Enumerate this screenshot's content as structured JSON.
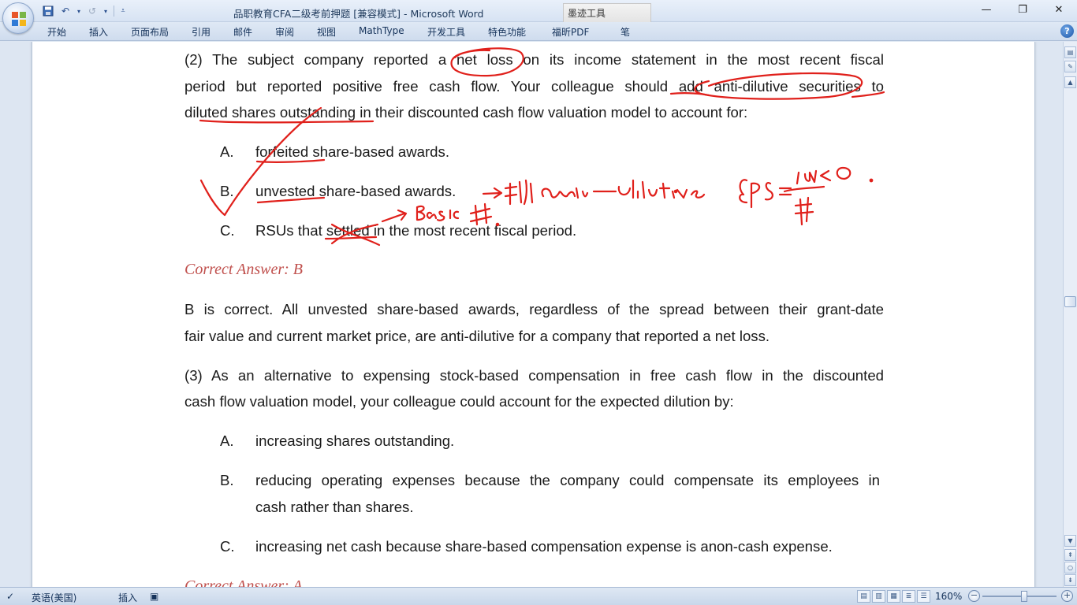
{
  "window": {
    "title": "品职教育CFA二级考前押题 [兼容模式] - Microsoft Word",
    "context_tab": "墨迹工具"
  },
  "ribbon": {
    "tabs": [
      "开始",
      "插入",
      "页面布局",
      "引用",
      "邮件",
      "审阅",
      "视图",
      "MathType",
      "开发工具",
      "特色功能",
      "福昕PDF",
      "笔"
    ]
  },
  "document": {
    "q2": {
      "lines": [
        "(2) The subject company reported a net loss on its income statement in the most recent fiscal",
        "period but reported positive free cash flow. Your colleague should add anti-dilutive securities to",
        "diluted shares outstanding in their discounted cash flow valuation model to account for:"
      ],
      "options": [
        {
          "letter": "A.",
          "text": "forfeited share-based awards."
        },
        {
          "letter": "B.",
          "text": "unvested share-based awards."
        },
        {
          "letter": "C.",
          "text": "RSUs that settled in the most recent fiscal period."
        }
      ],
      "answer": "Correct Answer: B",
      "explanation": [
        "B is correct. All unvested share-based awards, regardless of the spread between their grant-date",
        "fair value and current market price, are anti-dilutive for a company that reported a net loss."
      ]
    },
    "q3": {
      "lines": [
        "(3) As an alternative to expensing stock-based compensation in free cash flow in the discounted",
        "cash flow valuation model, your colleague could account for the expected dilution by:"
      ],
      "options": [
        {
          "letter": "A.",
          "text": "increasing shares outstanding."
        },
        {
          "letter": "B.",
          "text": "reducing operating expenses because the company could compensate its employees in",
          "text2": "cash rather than shares."
        },
        {
          "letter": "C.",
          "text": "increasing net cash because share-based compensation expense is anon-cash expense."
        }
      ],
      "answer": "Correct Answer: A"
    },
    "handwriting": {
      "note_b": "→ 剔 anti-dilutive .",
      "note_c": "→ Basic #.",
      "eps_formula": "EPS = NI <0 / #",
      "ink_color": "#e0201b"
    }
  },
  "statusbar": {
    "language": "英语(美国)",
    "insert_mode": "插入",
    "zoom": "160%"
  }
}
